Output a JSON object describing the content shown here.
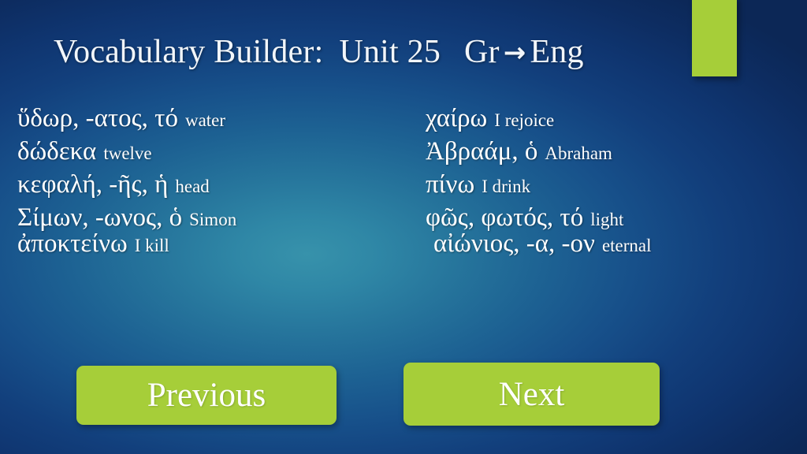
{
  "slide": {
    "title": {
      "main": "Vocabulary Builder:",
      "unit": "Unit 25",
      "source_lang": "Gr",
      "arrow": "→",
      "target_lang": "Eng"
    },
    "decor": {
      "green_bar_color": "#a6ce39",
      "background_center_color": "#3792ab",
      "background_edge_color": "#0c2756"
    },
    "columns": {
      "left": [
        {
          "greek": "ὕδωρ, -ατος, τό",
          "english": "water"
        },
        {
          "greek": "δώδεκα",
          "english": "twelve"
        },
        {
          "greek": "κεφαλή, -ῆς, ἡ",
          "english": "head"
        },
        {
          "greek": "Σίμων,  -ωνος,  ὁ",
          "english": "Simon"
        },
        {
          "greek": "ἀποκτείνω",
          "english": "I kill"
        }
      ],
      "right": [
        {
          "greek": "χαίρω",
          "english": "I rejoice"
        },
        {
          "greek": "Ἀβραάμ,  ὁ",
          "english": "Abraham"
        },
        {
          "greek": "πίνω",
          "english": "I drink"
        },
        {
          "greek": "φῶς,  φωτός,  τό",
          "english": "light"
        },
        {
          "greek": "αἰώνιος,  -α,  -ον",
          "english": "eternal"
        }
      ]
    },
    "navigation": {
      "previous_label": "Previous",
      "next_label": "Next"
    }
  }
}
